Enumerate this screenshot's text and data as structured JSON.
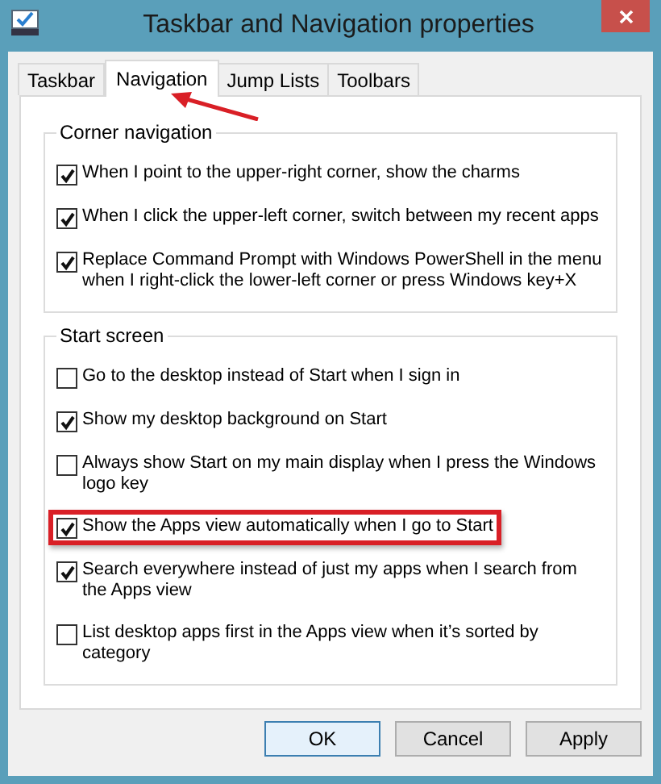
{
  "window": {
    "title": "Taskbar and Navigation properties"
  },
  "tabs": [
    {
      "label": "Taskbar",
      "selected": false,
      "annotated": false
    },
    {
      "label": "Navigation",
      "selected": true,
      "annotated": true
    },
    {
      "label": "Jump Lists",
      "selected": false,
      "annotated": false
    },
    {
      "label": "Toolbars",
      "selected": false,
      "annotated": false
    }
  ],
  "groups": [
    {
      "title": "Corner navigation",
      "items": [
        {
          "label": "When I point to the upper-right corner, show the charms",
          "checked": true,
          "highlighted": false
        },
        {
          "label": "When I click the upper-left corner, switch between my recent apps",
          "checked": true,
          "highlighted": false
        },
        {
          "label": "Replace Command Prompt with Windows PowerShell in the menu when I right-click the lower-left corner or press Windows key+X",
          "checked": true,
          "highlighted": false
        }
      ]
    },
    {
      "title": "Start screen",
      "items": [
        {
          "label": "Go to the desktop instead of Start when I sign in",
          "checked": false,
          "highlighted": false
        },
        {
          "label": "Show my desktop background on Start",
          "checked": true,
          "highlighted": false
        },
        {
          "label": "Always show Start on my main display when I press the Windows logo key",
          "checked": false,
          "highlighted": false
        },
        {
          "label": "Show the Apps view automatically when I go to Start",
          "checked": true,
          "highlighted": true
        },
        {
          "label": "Search everywhere instead of just my apps when I search from the Apps view",
          "checked": true,
          "highlighted": false
        },
        {
          "label": "List desktop apps first in the Apps view when it’s sorted by category",
          "checked": false,
          "highlighted": false
        }
      ]
    }
  ],
  "buttons": [
    {
      "label": "OK",
      "default": true
    },
    {
      "label": "Cancel",
      "default": false
    },
    {
      "label": "Apply",
      "default": false
    }
  ]
}
